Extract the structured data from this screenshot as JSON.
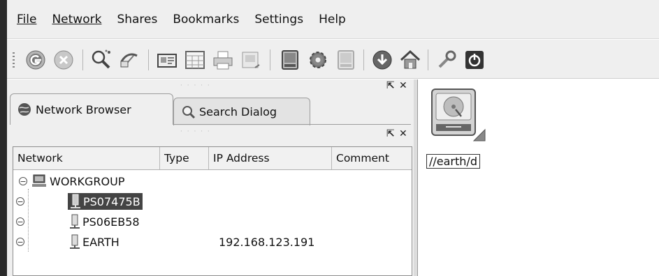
{
  "menu": [
    "File",
    "Network",
    "Shares",
    "Bookmarks",
    "Settings",
    "Help"
  ],
  "toolbar_icons": [
    "scan-network-icon",
    "abort-icon",
    "search-icon",
    "remount-icon",
    "mount-dialog-icon",
    "custom-view-icon",
    "print-icon",
    "preview-icon",
    "drive-icon",
    "configure-icon",
    "drive-disabled-icon",
    "download-icon",
    "home-icon",
    "tools-icon",
    "power-icon"
  ],
  "tabs": {
    "network_browser": "Network Browser",
    "search_dialog": "Search Dialog"
  },
  "dock": {
    "dots": "· · · · ·",
    "float": "⇱",
    "close": "✕"
  },
  "columns": [
    "Network",
    "Type",
    "IP Address",
    "Comment"
  ],
  "tree": {
    "workgroup": "WORKGROUP",
    "hosts": [
      {
        "name": "PS07475B",
        "ip": "",
        "selected": true
      },
      {
        "name": "PS06EB58",
        "ip": ""
      },
      {
        "name": "EARTH",
        "ip": "192.168.123.191"
      }
    ]
  },
  "share": {
    "label": "//earth/d"
  },
  "colors": {
    "selection": "#444444",
    "panel": "#efefef"
  }
}
